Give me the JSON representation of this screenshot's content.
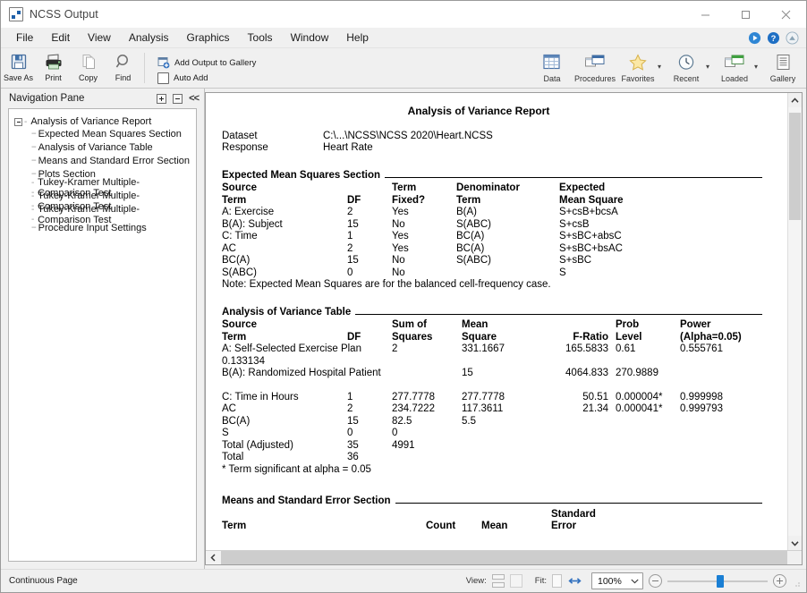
{
  "window": {
    "title": "NCSS Output",
    "app_icon": "ncss-icon",
    "controls": [
      {
        "name": "minimize-button",
        "glyph": "minimize-icon"
      },
      {
        "name": "maximize-button",
        "glyph": "maximize-icon"
      },
      {
        "name": "close-button",
        "glyph": "close-icon"
      }
    ]
  },
  "menubar": {
    "items": [
      {
        "label": "File"
      },
      {
        "label": "Edit"
      },
      {
        "label": "View"
      },
      {
        "label": "Analysis"
      },
      {
        "label": "Graphics"
      },
      {
        "label": "Tools"
      },
      {
        "label": "Window"
      },
      {
        "label": "Help"
      }
    ],
    "right_icons": [
      {
        "name": "run-icon"
      },
      {
        "name": "help-icon"
      },
      {
        "name": "support-icon"
      }
    ]
  },
  "toolbar": {
    "left_buttons": [
      {
        "label": "Save As",
        "icon": "save-icon"
      },
      {
        "label": "Print",
        "icon": "printer-icon"
      },
      {
        "label": "Copy",
        "icon": "copy-icon"
      },
      {
        "label": "Find",
        "icon": "magnifier-icon"
      }
    ],
    "gallery": {
      "add_output_label": "Add Output to Gallery",
      "add_output_icon": "add-output-icon",
      "auto_add_label": "Auto Add",
      "auto_add_checked": false
    },
    "right_buttons": [
      {
        "label": "Data",
        "icon": "data-grid-icon",
        "has_caret": false
      },
      {
        "label": "Procedures",
        "icon": "procedures-windows-icon",
        "has_caret": false
      },
      {
        "label": "Favorites",
        "icon": "star-icon",
        "has_caret": true
      },
      {
        "label": "Recent",
        "icon": "clock-icon",
        "has_caret": true
      },
      {
        "label": "Loaded",
        "icon": "loaded-windows-icon",
        "has_caret": true
      },
      {
        "label": "Gallery",
        "icon": "gallery-lines-icon",
        "has_caret": false
      }
    ]
  },
  "navigation_pane": {
    "title": "Navigation Pane",
    "buttons": [
      {
        "name": "expand-all-button",
        "glyph": "plus-box-icon"
      },
      {
        "name": "collapse-all-button",
        "glyph": "minus-box-icon"
      },
      {
        "name": "hide-pane-button",
        "glyph": "<<"
      }
    ],
    "tree": {
      "root": "Analysis of Variance Report",
      "children": [
        "Expected Mean Squares Section",
        "Analysis of Variance Table",
        "Means and Standard Error Section",
        "Plots Section",
        "Tukey-Kramer Multiple-Comparison Test",
        "Tukey-Kramer Multiple-Comparison Test",
        "Tukey-Kramer Multiple-Comparison Test",
        "Procedure Input Settings"
      ]
    }
  },
  "report": {
    "title": "Analysis of Variance Report",
    "meta": [
      {
        "label": "Dataset",
        "value": "C:\\...\\NCSS\\NCSS 2020\\Heart.NCSS"
      },
      {
        "label": "Response",
        "value": "Heart Rate"
      }
    ],
    "expected_mean_squares": {
      "heading": "Expected Mean Squares Section",
      "header_line1": [
        "Source",
        "",
        "Term",
        "Denominator",
        "Expected"
      ],
      "header_line2": [
        "Term",
        "DF",
        "Fixed?",
        "Term",
        "Mean Square"
      ],
      "rows": [
        {
          "term": "A: Exercise",
          "df": "2",
          "fixed": "Yes",
          "denominator": "B(A)",
          "ems": "S+csB+bcsA"
        },
        {
          "term": "B(A): Subject",
          "df": "15",
          "fixed": "No",
          "denominator": "S(ABC)",
          "ems": "S+csB"
        },
        {
          "term": "C: Time",
          "df": "1",
          "fixed": "Yes",
          "denominator": "BC(A)",
          "ems": "S+sBC+absC"
        },
        {
          "term": "AC",
          "df": "2",
          "fixed": "Yes",
          "denominator": "BC(A)",
          "ems": "S+sBC+bsAC"
        },
        {
          "term": "BC(A)",
          "df": "15",
          "fixed": "No",
          "denominator": "S(ABC)",
          "ems": "S+sBC"
        },
        {
          "term": "S(ABC)",
          "df": "0",
          "fixed": "No",
          "denominator": "",
          "ems": "S"
        }
      ],
      "note": "Note: Expected Mean Squares are for the balanced cell-frequency case."
    },
    "anova_table": {
      "heading": "Analysis of Variance Table",
      "header_line1": [
        "Source",
        "",
        "Sum of",
        "Mean",
        "",
        "Prob",
        "Power"
      ],
      "header_line2": [
        "Term",
        "DF",
        "Squares",
        "Square",
        "F-Ratio",
        "Level",
        "(Alpha=0.05)"
      ],
      "rows": [
        {
          "term": "A: Self-Selected Exercise Plan",
          "df": "2",
          "ss": "",
          "ms": "331.1667",
          "f": "165.5833",
          "p": "0.61",
          "power": "0.555761",
          "wrap": "0.133134"
        },
        {
          "term": "B(A): Randomized Hospital Patient",
          "df": "",
          "ss": "15",
          "ms": "",
          "f": "4064.833",
          "p": "270.9889",
          "power": "",
          "wrap": ""
        },
        {
          "term": "",
          "df": "",
          "ss": "",
          "ms": "",
          "f": "",
          "p": "",
          "power": "",
          "wrap": "",
          "blank": true
        },
        {
          "term": "C: Time in Hours",
          "df": "1",
          "ss": "277.7778",
          "ms": "277.7778",
          "f": "50.51",
          "p": "0.000004*",
          "power": "0.999998",
          "wrap": ""
        },
        {
          "term": "AC",
          "df": "2",
          "ss": "234.7222",
          "ms": "117.3611",
          "f": "21.34",
          "p": "0.000041*",
          "power": "0.999793",
          "wrap": ""
        },
        {
          "term": "BC(A)",
          "df": "15",
          "ss": "82.5",
          "ms": "5.5",
          "f": "",
          "p": "",
          "power": "",
          "wrap": ""
        },
        {
          "term": "S",
          "df": "0",
          "ss": "0",
          "ms": "",
          "f": "",
          "p": "",
          "power": "",
          "wrap": ""
        },
        {
          "term": "Total (Adjusted)",
          "df": "35",
          "ss": "4991",
          "ms": "",
          "f": "",
          "p": "",
          "power": "",
          "wrap": ""
        },
        {
          "term": "Total",
          "df": "36",
          "ss": "",
          "ms": "",
          "f": "",
          "p": "",
          "power": "",
          "wrap": ""
        }
      ],
      "footnote": "* Term significant at alpha = 0.05"
    },
    "means_section": {
      "heading": "Means and Standard Error Section",
      "header_line1": [
        "",
        "",
        "",
        "Standard"
      ],
      "header_line2": [
        "Term",
        "Count",
        "Mean",
        "Error"
      ]
    }
  },
  "statusbar": {
    "left_text": "Continuous Page",
    "view_label": "View:",
    "fit_label": "Fit:",
    "zoom_value": "100%",
    "zoom_out_name": "zoom-out-button",
    "zoom_in_name": "zoom-in-button"
  }
}
